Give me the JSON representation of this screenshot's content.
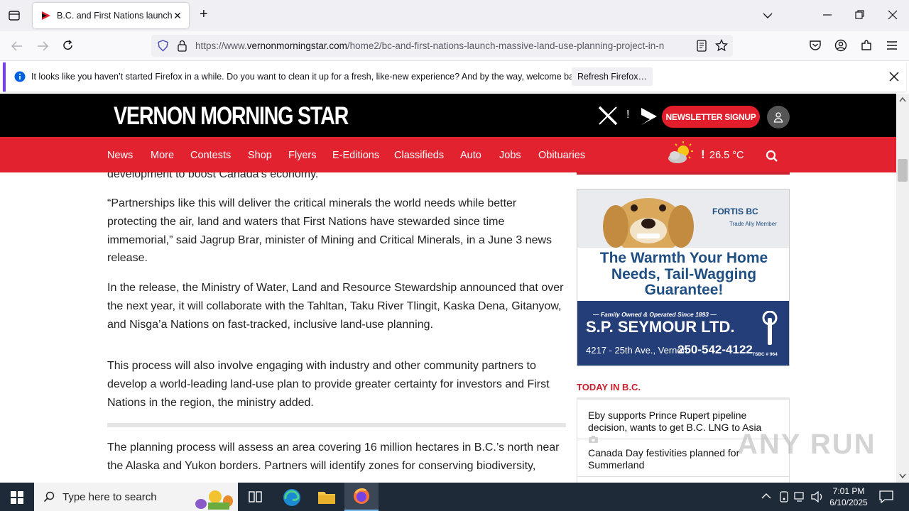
{
  "browser": {
    "tab_title": "B.C. and First Nations launch massive land-use planning project",
    "url_prefix": "https://www.",
    "url_domain": "vernonmorningstar.com",
    "url_path": "/home2/bc-and-first-nations-launch-massive-land-use-planning-project-in-n",
    "notification": "It looks like you haven’t started Firefox in a while. Do you want to clean it up for a fresh, like-new experience? And by the way, welcome back!",
    "refresh_button": "Refresh Firefox…"
  },
  "site": {
    "logo": "VERNON MORNING STAR",
    "newsletter_button": "NEWSLETTER SIGNUP",
    "nav": [
      "News",
      "More",
      "Contests",
      "Shop",
      "Flyers",
      "E-Editions",
      "Classifieds",
      "Auto",
      "Jobs",
      "Obituaries"
    ],
    "temperature": "26.5 °C"
  },
  "article": {
    "fragment": "development to boost Canada’s economy.",
    "p1": "“Partnerships like this will deliver the critical minerals the world needs while better protecting the air, land and waters that First Nations have stewarded since time immemorial,” said Jagrup Brar, minister of Mining and Critical Minerals, in a June 3 news release.",
    "p2": "In the release, the Ministry of Water, Land and Resource Stewardship announced that over the next year, it will collaborate with the Tahltan, Taku River Tlingit, Kaska Dena, Gitanyow, and Nisga’a Nations on fast-tracked, inclusive land-use planning.",
    "p3": "This process will also involve engaging with industry and other community partners to develop a world-leading land-use plan to provide greater certainty for investors and First Nations in the region, the ministry added.",
    "p4": "The planning process will assess an area covering 16 million hectares in B.C.’s north near the Alaska and Yukon borders. Partners will identify zones for conserving biodiversity,"
  },
  "ad": {
    "brand": "FORTIS BC",
    "brand_sub": "Trade Ally Member",
    "headline": "The Warmth Your Home Needs, Tail-Wagging Guarantee!",
    "tagline": "— Family Owned & Operated Since 1893 —",
    "company": "S.P. SEYMOUR LTD.",
    "address": "4217 - 25th Ave., Vernon",
    "phone": "250-542-4122",
    "license": "TSBC # 964"
  },
  "sidebar": {
    "heading": "TODAY IN B.C.",
    "items": [
      "Eby supports Prince Rupert pipeline decision, wants to get B.C. LNG to Asia",
      "Canada Day festivities planned for Summerland"
    ]
  },
  "taskbar": {
    "search_placeholder": "Type here to search",
    "time": "7:01 PM",
    "date": "6/10/2025"
  },
  "watermark": "ANY RUN",
  "colors": {
    "accent": "#e3222f",
    "ad_blue": "#243e7a"
  }
}
